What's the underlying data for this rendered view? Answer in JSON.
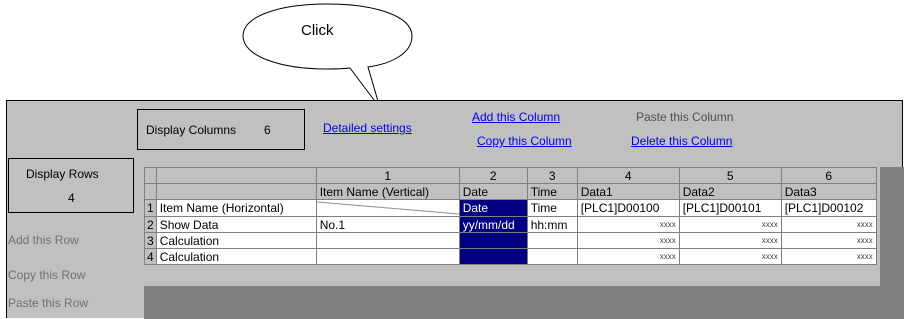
{
  "callout": {
    "text": "Click"
  },
  "toolbar": {
    "display_columns_label": "Display Columns",
    "display_columns_value": "6",
    "detailed_settings": "Detailed settings",
    "add_column": "Add this Column",
    "copy_column": "Copy this Column",
    "paste_column": "Paste this Column",
    "delete_column": "Delete this Column"
  },
  "sidebar": {
    "display_rows_label": "Display Rows",
    "display_rows_value": "4",
    "add_row": "Add this Row",
    "copy_row": "Copy this Row",
    "paste_row": "Paste this Row"
  },
  "grid": {
    "column_numbers": [
      "1",
      "2",
      "3",
      "4",
      "5",
      "6"
    ],
    "column_names": [
      "Item Name (Vertical)",
      "Date",
      "Time",
      "Data1",
      "Data2",
      "Data3"
    ],
    "rows": [
      {
        "num": "1",
        "label": "Item Name (Horizontal)",
        "cells": [
          "",
          "Date",
          "Time",
          "[PLC1]D00100",
          "[PLC1]D00101",
          "[PLC1]D00102"
        ]
      },
      {
        "num": "2",
        "label": "Show Data",
        "cells": [
          "No.1",
          "yy/mm/dd",
          "hh:mm",
          "xxxx",
          "xxxx",
          "xxxx"
        ]
      },
      {
        "num": "3",
        "label": "Calculation",
        "cells": [
          "",
          "",
          "",
          "xxxx",
          "xxxx",
          "xxxx"
        ]
      },
      {
        "num": "4",
        "label": "Calculation",
        "cells": [
          "",
          "",
          "",
          "xxxx",
          "xxxx",
          "xxxx"
        ]
      }
    ]
  },
  "colors": {
    "panel": "#c0c0c0",
    "link": "#0000ee",
    "selection": "#000080",
    "dark_band": "#808080"
  }
}
